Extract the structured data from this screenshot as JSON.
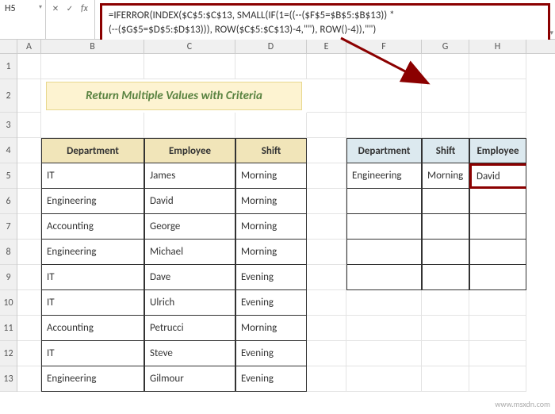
{
  "nameBox": "H5",
  "fx": "fx",
  "formula": {
    "line1": "=IFERROR(INDEX($C$5:$C$13, SMALL(IF(1=((--($F$5=$B$5:$B$13)) *",
    "line2": "(--($G$5=$D$5:$D$13))), ROW($C$5:$C$13)-4,\"\"), ROW()-4)),\"\")"
  },
  "columns": [
    "A",
    "B",
    "C",
    "D",
    "E",
    "F",
    "G",
    "H"
  ],
  "rows": [
    "1",
    "2",
    "3",
    "4",
    "5",
    "6",
    "7",
    "8",
    "9",
    "10",
    "11",
    "12",
    "13"
  ],
  "title": "Return Multiple Values with Criteria",
  "table1": {
    "headers": [
      "Department",
      "Employee",
      "Shift"
    ],
    "rows": [
      [
        "IT",
        "James",
        "Morning"
      ],
      [
        "Engineering",
        "David",
        "Morning"
      ],
      [
        "Accounting",
        "George",
        "Morning"
      ],
      [
        "Engineering",
        "Michael",
        "Morning"
      ],
      [
        "IT",
        "Dave",
        "Evening"
      ],
      [
        "IT",
        "Ulrich",
        "Evening"
      ],
      [
        "Accounting",
        "Petrucci",
        "Morning"
      ],
      [
        "IT",
        "Steve",
        "Evening"
      ],
      [
        "Engineering",
        "Gilmour",
        "Evening"
      ]
    ]
  },
  "table2": {
    "headers": [
      "Department",
      "Shift",
      "Employee"
    ],
    "rows": [
      [
        "Engineering",
        "Morning",
        "David"
      ],
      [
        "",
        "",
        ""
      ],
      [
        "",
        "",
        ""
      ],
      [
        "",
        "",
        ""
      ],
      [
        "",
        "",
        ""
      ]
    ]
  },
  "watermark": "www.msxdn.com"
}
